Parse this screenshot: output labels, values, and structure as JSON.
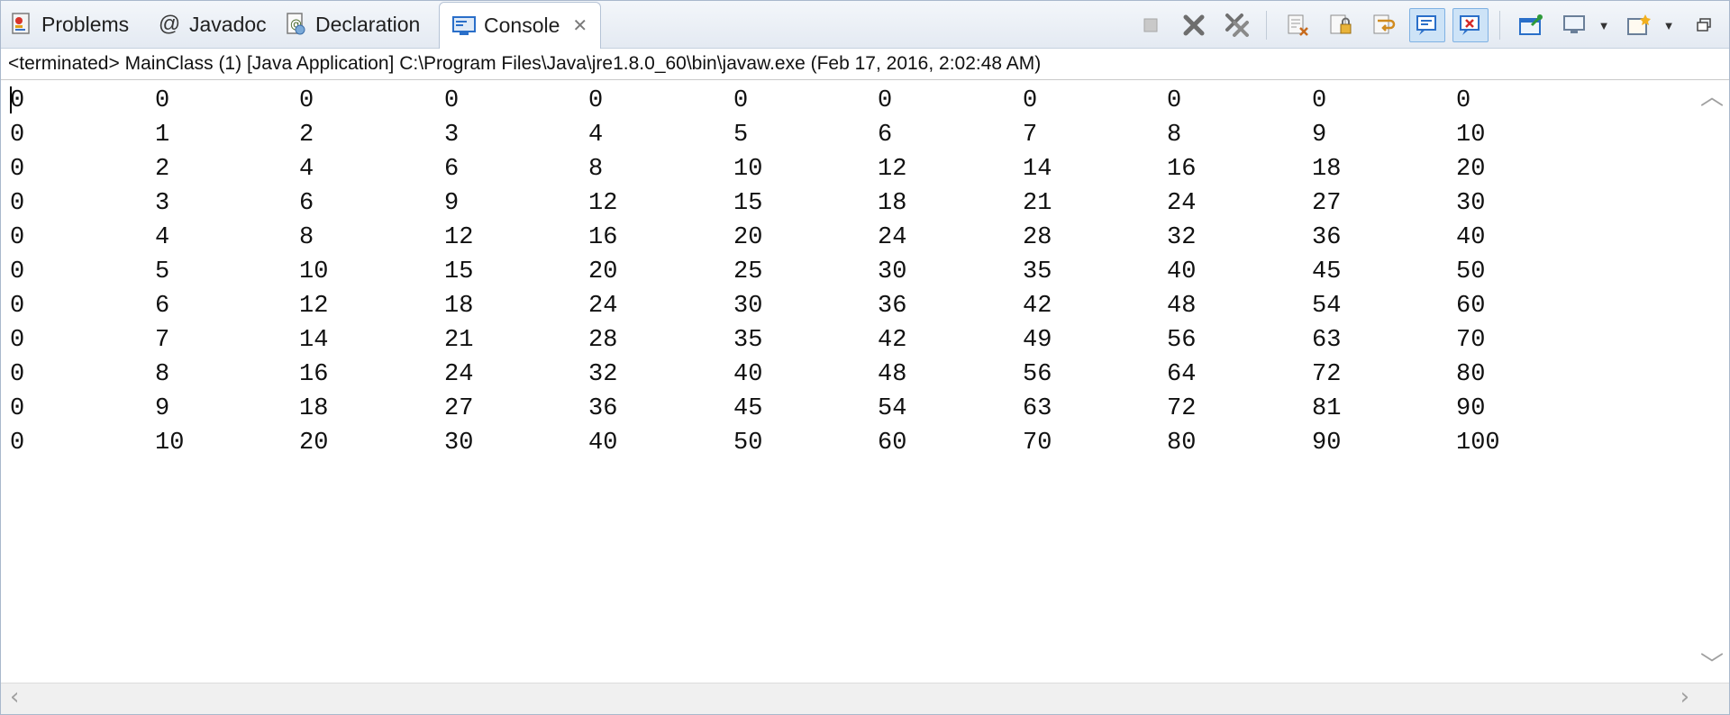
{
  "tabs": [
    {
      "label": "Problems",
      "icon": "problems-icon"
    },
    {
      "label": "Javadoc",
      "icon": "at-icon"
    },
    {
      "label": "Declaration",
      "icon": "declaration-icon"
    },
    {
      "label": "Console",
      "icon": "console-icon",
      "active": true,
      "closable": true
    }
  ],
  "toolbar": {
    "buttons": [
      "terminate-icon",
      "remove-launch-icon",
      "remove-all-terminated-icon",
      "clear-console-icon",
      "scroll-lock-icon",
      "word-wrap-icon",
      "show-on-stdout-icon",
      "show-on-stderr-icon",
      "pin-console-icon",
      "display-console-icon",
      "open-console-icon",
      "minimize-icon"
    ],
    "pressed": [
      "show-on-stdout-icon",
      "show-on-stderr-icon"
    ]
  },
  "status_line": "<terminated> MainClass (1) [Java Application] C:\\Program Files\\Java\\jre1.8.0_60\\bin\\javaw.exe (Feb 17, 2016, 2:02:48 AM)",
  "console": {
    "rows": [
      [
        "0",
        "0",
        "0",
        "0",
        "0",
        "0",
        "0",
        "0",
        "0",
        "0",
        "0"
      ],
      [
        "0",
        "1",
        "2",
        "3",
        "4",
        "5",
        "6",
        "7",
        "8",
        "9",
        "10"
      ],
      [
        "0",
        "2",
        "4",
        "6",
        "8",
        "10",
        "12",
        "14",
        "16",
        "18",
        "20"
      ],
      [
        "0",
        "3",
        "6",
        "9",
        "12",
        "15",
        "18",
        "21",
        "24",
        "27",
        "30"
      ],
      [
        "0",
        "4",
        "8",
        "12",
        "16",
        "20",
        "24",
        "28",
        "32",
        "36",
        "40"
      ],
      [
        "0",
        "5",
        "10",
        "15",
        "20",
        "25",
        "30",
        "35",
        "40",
        "45",
        "50"
      ],
      [
        "0",
        "6",
        "12",
        "18",
        "24",
        "30",
        "36",
        "42",
        "48",
        "54",
        "60"
      ],
      [
        "0",
        "7",
        "14",
        "21",
        "28",
        "35",
        "42",
        "49",
        "56",
        "63",
        "70"
      ],
      [
        "0",
        "8",
        "16",
        "24",
        "32",
        "40",
        "48",
        "56",
        "64",
        "72",
        "80"
      ],
      [
        "0",
        "9",
        "18",
        "27",
        "36",
        "45",
        "54",
        "63",
        "72",
        "81",
        "90"
      ],
      [
        "0",
        "10",
        "20",
        "30",
        "40",
        "50",
        "60",
        "70",
        "80",
        "90",
        "100"
      ]
    ]
  },
  "colors": {
    "tab_bar": "#e4eaf2",
    "pressed_button": "#cde3f7",
    "accent_blue": "#2a6fc9"
  }
}
